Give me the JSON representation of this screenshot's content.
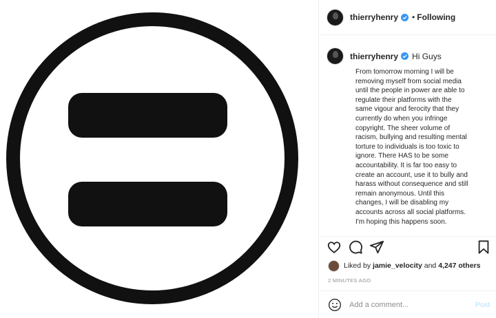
{
  "post": {
    "author": "thierryhenry",
    "following_label": "Following",
    "separator": "•"
  },
  "caption": {
    "author": "thierryhenry",
    "greeting": "Hi Guys",
    "lines": [
      "From tomorrow morning I will be",
      "removing myself from social media",
      "until the people in power are able to",
      "regulate their platforms with the",
      "same vigour and ferocity that they",
      "currently do when you infringe",
      "copyright. The sheer volume of",
      "racism, bullying and resulting mental",
      "torture to individuals is too toxic to",
      "ignore. There HAS to be some",
      "accountability. It is far too easy to",
      "create an account, use it to bully and",
      "harass without consequence and still",
      "remain anonymous. Until this",
      "changes, I will be disabling my",
      "accounts across all social platforms.",
      "I'm hoping this happens soon."
    ]
  },
  "likes": {
    "prefix": "Liked by",
    "user": "jamie_velocity",
    "and": "and",
    "others": "4,247 others"
  },
  "timestamp": "2 MINUTES AGO",
  "comment": {
    "placeholder": "Add a comment...",
    "post_label": "Post"
  },
  "icons": {
    "verified": "verified-badge-icon",
    "like": "heart-icon",
    "comment": "comment-bubble-icon",
    "share": "paper-plane-icon",
    "save": "bookmark-icon",
    "emoji": "smiley-icon"
  },
  "colors": {
    "verified": "#3897f0",
    "post_disabled": "#b2dffc",
    "muted": "#8e8e8e",
    "border": "#efefef"
  }
}
